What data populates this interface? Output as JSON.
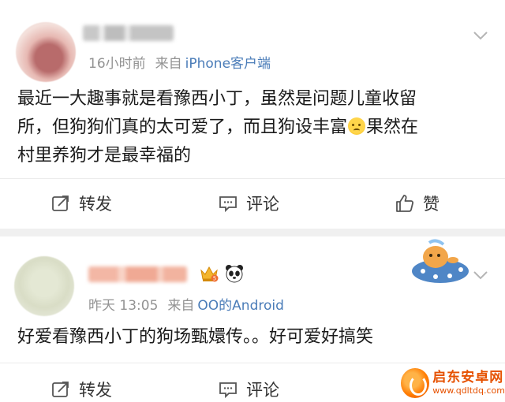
{
  "posts": [
    {
      "time": "16小时前",
      "from_label": "来自",
      "source": "iPhone客户端",
      "content_lines": [
        "最近一大趣事就是看豫西小丁，虽然是问题儿童收留",
        "所，但狗狗们真的太可爱了，而且狗设丰富",
        "果然在",
        "村里养狗才是最幸福的"
      ],
      "actions": {
        "repost": "转发",
        "comment": "评论",
        "like": "赞"
      }
    },
    {
      "time": "昨天 13:05",
      "from_label": "来自",
      "source": "OO的Android",
      "badge_level": "5",
      "content_lines": [
        "好爱看豫西小丁的狗场甄嬛传。。好可爱好搞笑"
      ],
      "actions": {
        "repost": "转发",
        "comment": "评论"
      }
    }
  ],
  "watermark": {
    "title": "启东安卓网",
    "url": "www.qdltdq.com"
  },
  "colors": {
    "link": "#4a7cb8",
    "meta": "#939393",
    "separator": "#f0f0f0"
  },
  "icons": [
    "chevron-down-icon",
    "repost-icon",
    "comment-icon",
    "like-icon",
    "crown-badge-icon",
    "panda-icon"
  ]
}
